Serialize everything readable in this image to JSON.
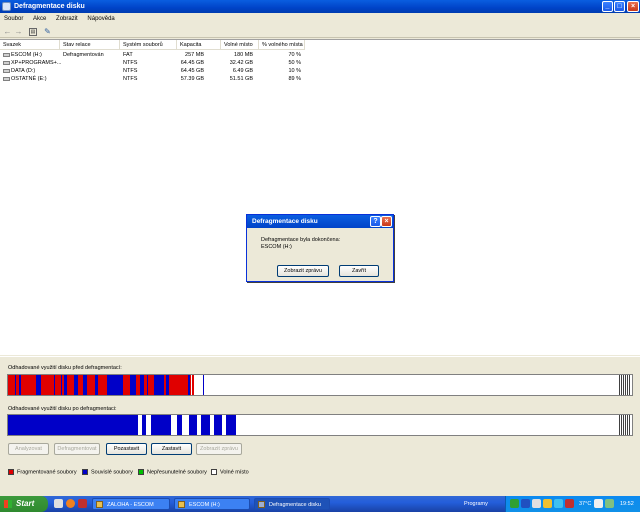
{
  "window": {
    "title": "Defragmentace disku"
  },
  "menu": [
    "Soubor",
    "Akce",
    "Zobrazit",
    "Nápověda"
  ],
  "table": {
    "columns": [
      "Svazek",
      "Stav relace",
      "Systém souborů",
      "Kapacita",
      "Volné místo",
      "% volného místa"
    ],
    "rows": [
      [
        "ESCOM (H:)",
        "Defragmentován",
        "FAT",
        "257 MB",
        "180 MB",
        "70 %"
      ],
      [
        "XP+PROGRAMS+...",
        "",
        "NTFS",
        "64.45 GB",
        "32.42 GB",
        "50 %"
      ],
      [
        "DATA (D:)",
        "",
        "NTFS",
        "64.45 GB",
        "6.49 GB",
        "10 %"
      ],
      [
        "OSTATNÉ (E:)",
        "",
        "NTFS",
        "57.39 GB",
        "51.51 GB",
        "89 %"
      ]
    ]
  },
  "analysis": {
    "before_label": "Odhadované využití disku před defragmentací:",
    "after_label": "Odhadované využití disku po defragmentaci:"
  },
  "buttons": {
    "analyze": "Analyzovat",
    "defrag": "Defragmentovat",
    "pause": "Pozastavit",
    "stop": "Zastavit",
    "report": "Zobrazit zprávu"
  },
  "legend": [
    {
      "label": "Fragmentované soubory",
      "color": "#e00000"
    },
    {
      "label": "Souvislé soubory",
      "color": "#0000c8"
    },
    {
      "label": "Nepřesunutelné soubory",
      "color": "#00c000"
    },
    {
      "label": "Volné místo",
      "color": "#ffffff"
    }
  ],
  "dialog": {
    "title": "Defragmentace disku",
    "message": "Defragmentace byla dokončena:",
    "volume": "ESCOM (H:)",
    "show_report": "Zobrazit zprávu",
    "close": "Zavřít"
  },
  "taskbar": {
    "start": "Start",
    "tasks": [
      "ZALOHA - ESCOM",
      "ESCOM (H:)",
      "Defragmentace disku"
    ],
    "programs": "Programy",
    "temperature": "37°C",
    "clock": "19:52"
  },
  "colors": {
    "fragmented": "#e00000",
    "contiguous": "#0000c8",
    "unmovable": "#00c000",
    "free": "#ffffff",
    "titlebar": "#0043c8"
  }
}
